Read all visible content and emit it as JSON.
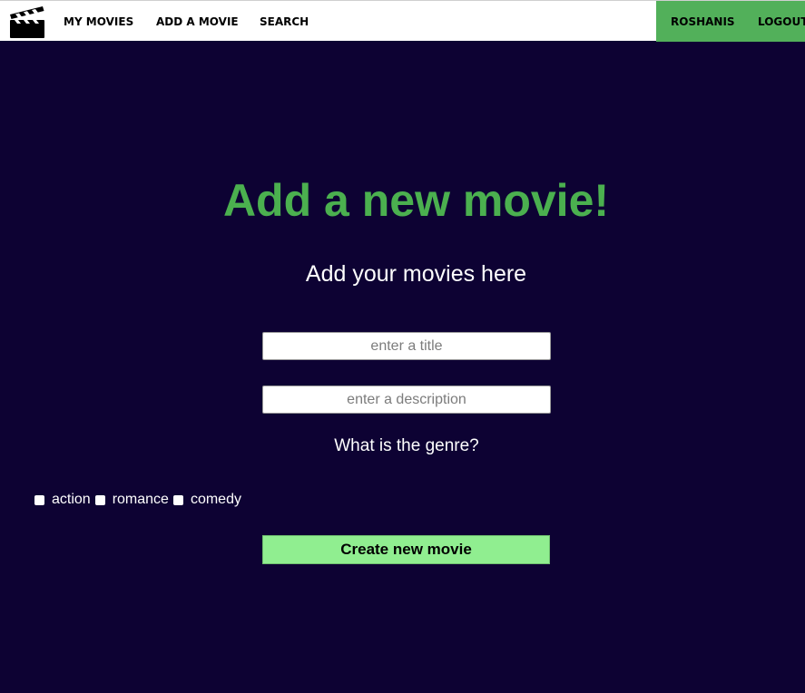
{
  "nav": {
    "logo_icon": "clapperboard-icon",
    "links": [
      "MY MOVIES",
      "ADD A MOVIE",
      "SEARCH"
    ],
    "user": "ROSHANIS",
    "logout": "LOGOUT",
    "accent": "#52b05a"
  },
  "main": {
    "title": "Add a new movie!",
    "subtitle": "Add your movies here",
    "title_placeholder": "enter a title",
    "title_value": "",
    "description_placeholder": "enter a description",
    "description_value": "",
    "genre_question": "What is the genre?",
    "genres": [
      "action",
      "romance",
      "comedy"
    ],
    "submit_label": "Create new movie",
    "title_color": "#4bb04f",
    "background": "#0d0233",
    "button_color": "#90ee90"
  }
}
